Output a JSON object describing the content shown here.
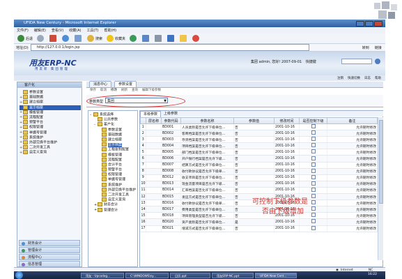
{
  "browser": {
    "title": "UFIDA New Century - Microsoft Internet Explorer",
    "menu": [
      "文件(F)",
      "编辑(E)",
      "查看(V)",
      "收藏(A)",
      "工具(T)",
      "帮助(H)"
    ],
    "toolbar": {
      "back": "后退",
      "search": "搜索",
      "favorites": "收藏夹"
    },
    "address_label": "地址(D)",
    "address": "http://127.0.0.1/login.jsp",
    "go": "转到",
    "links": "链接"
  },
  "app": {
    "logo": "用友ERP-NC",
    "logo_sub": "用友新    集团管理",
    "user_info": "集团 admin, 您好! 2007-09-01",
    "shortcut": "快捷键",
    "links": [
      "注销",
      "快速切换",
      "日志",
      "帮助"
    ]
  },
  "leftnav": {
    "header": "客户化",
    "items": [
      {
        "label": "参数设置",
        "exp": "",
        "sel": false
      },
      {
        "label": "基础数据",
        "exp": "+",
        "sel": false
      },
      {
        "label": "建立档案",
        "exp": "+",
        "sel": false
      },
      {
        "label": "显示档案",
        "exp": "+",
        "sel": true
      },
      {
        "label": "模板管理",
        "exp": "+",
        "sel": false
      },
      {
        "label": "流程配置",
        "exp": "+",
        "sel": false
      },
      {
        "label": "预警平台",
        "exp": "+",
        "sel": false
      },
      {
        "label": "权限管理",
        "exp": "+",
        "sel": false
      },
      {
        "label": "单据号管理",
        "exp": "+",
        "sel": false
      },
      {
        "label": "系统维护",
        "exp": "+",
        "sel": false
      },
      {
        "label": "外部交换平台维护",
        "exp": "+",
        "sel": false
      },
      {
        "label": "二次开发工具",
        "exp": "+",
        "sel": false
      },
      {
        "label": "自定义查询",
        "exp": "+",
        "sel": false
      }
    ],
    "bottom": [
      "财务会计",
      "管理会计",
      "流程中心",
      "信息管理"
    ]
  },
  "main": {
    "tabs": [
      "消息中心",
      "参数设置"
    ],
    "actions": [
      "保存",
      "取消",
      "修改",
      "刷新",
      "查询",
      "编辑下级参数"
    ],
    "filter_label": "参数类型",
    "filter_value": "集团",
    "tree": [
      {
        "label": "系统选择",
        "exp": "-",
        "indent": 0,
        "sel": false
      },
      {
        "label": "公共参数",
        "exp": "",
        "indent": 1,
        "sel": false
      },
      {
        "label": "客户化",
        "exp": "-",
        "indent": 1,
        "sel": false
      },
      {
        "label": "参数设置",
        "exp": "",
        "indent": 2,
        "sel": false
      },
      {
        "label": "基础数据",
        "exp": "",
        "indent": 2,
        "sel": false
      },
      {
        "label": "建立档案",
        "exp": "",
        "indent": 2,
        "sel": false
      },
      {
        "label": "显示档案",
        "exp": "",
        "indent": 2,
        "sel": true
      },
      {
        "label": "工程复制配置",
        "exp": "",
        "indent": 2,
        "sel": false
      },
      {
        "label": "模板管理",
        "exp": "",
        "indent": 2,
        "sel": false
      },
      {
        "label": "流程配置",
        "exp": "",
        "indent": 2,
        "sel": false
      },
      {
        "label": "会计平台",
        "exp": "",
        "indent": 2,
        "sel": false
      },
      {
        "label": "预警平台",
        "exp": "",
        "indent": 2,
        "sel": false
      },
      {
        "label": "权限管理",
        "exp": "",
        "indent": 2,
        "sel": false
      },
      {
        "label": "单据号管理",
        "exp": "",
        "indent": 2,
        "sel": false
      },
      {
        "label": "系统维护",
        "exp": "",
        "indent": 2,
        "sel": false
      },
      {
        "label": "外部交换平台维护",
        "exp": "",
        "indent": 2,
        "sel": false
      },
      {
        "label": "二次开发工具",
        "exp": "",
        "indent": 2,
        "sel": false
      },
      {
        "label": "自定义查询",
        "exp": "",
        "indent": 2,
        "sel": false
      },
      {
        "label": "财务会计",
        "exp": "+",
        "indent": 1,
        "sel": false
      },
      {
        "label": "管理会计",
        "exp": "+",
        "indent": 1,
        "sel": false
      }
    ],
    "subtabs": [
      "本级参数",
      "上级参数"
    ],
    "columns": [
      "",
      "层名称",
      "参数代码",
      "参数名称",
      "参数值",
      "修改时间",
      "是否控制下级",
      "备注"
    ],
    "rows": [
      {
        "n": "1",
        "code": "BD001",
        "name": "人员类别是否允许下级单位…",
        "val": "否",
        "time": "2001-10-16",
        "note": "允许随时修改"
      },
      {
        "n": "2",
        "code": "BD002",
        "name": "客商档案是否允许下级单位…",
        "val": "否",
        "time": "2001-10-16",
        "note": "允许随时修改"
      },
      {
        "n": "3",
        "code": "BD003",
        "name": "存货档案是否允许下级单位…",
        "val": "否",
        "time": "2001-10-16",
        "note": "允许随时修改"
      },
      {
        "n": "4",
        "code": "BD004",
        "name": "项目档案是否允许下级单位…",
        "val": "否",
        "time": "2001-10-16",
        "note": "允许随时修改"
      },
      {
        "n": "5",
        "code": "BD005",
        "name": "部门档案是否允许下级单位…",
        "val": "否",
        "time": "2001-10-16",
        "note": "允许随时修改"
      },
      {
        "n": "6",
        "code": "BD006",
        "name": "开户银行档案是否允许下级…",
        "val": "否",
        "time": "2001-10-16",
        "note": "允许随时修改"
      },
      {
        "n": "7",
        "code": "BD007",
        "name": "结算方式是否允许下级单位…",
        "val": "否",
        "time": "2001-10-16",
        "note": "允许随时修改"
      },
      {
        "n": "8",
        "code": "BD008",
        "name": "收付款协议是否允许下级单…",
        "val": "否",
        "time": "2001-10-16",
        "note": "允许随时修改"
      },
      {
        "n": "9",
        "code": "BD012",
        "name": "收支项目是否允许下级单位…",
        "val": "否",
        "time": "2001-10-16",
        "note": "允许随时修改"
      },
      {
        "n": "10",
        "code": "BD013",
        "name": "现金流量项目是否允许下级…",
        "val": "否",
        "time": "2001-10-16",
        "note": "允许随时修改"
      },
      {
        "n": "11",
        "code": "BD014",
        "name": "汇率档案是否允许下级单位…",
        "val": "否",
        "time": "2001-10-16",
        "note": "允许随时修改"
      },
      {
        "n": "12",
        "code": "BD015",
        "name": "发运方式是否允许下级单位…",
        "val": "否",
        "time": "2001-10-16",
        "note": "允许随时修改"
      },
      {
        "n": "13",
        "code": "BD016",
        "name": "收付款协议是否允许下级单…",
        "val": "否",
        "time": "2001-10-16",
        "note": "允许随时修改"
      },
      {
        "n": "14",
        "code": "BD017",
        "name": "费用类型是否允许下级单位…",
        "val": "否",
        "time": "2001-10-16",
        "note": "允许随时修改"
      },
      {
        "n": "15",
        "code": "BD018",
        "name": "项目管理类型是否允许下级…",
        "val": "否",
        "time": "2001-10-16",
        "note": "允许随时修改"
      },
      {
        "n": "16",
        "code": "BD020",
        "name": "资产类别是否允许下级单位…",
        "val": "是",
        "time": "2001-10-16",
        "note": "允许随时修改"
      },
      {
        "n": "17",
        "code": "BD021",
        "name": "增减方式是否允许下级单位…",
        "val": "否",
        "time": "2001-10-16",
        "note": "允许随时修改"
      }
    ],
    "annotation": [
      "可控制下级参数是",
      "否由下级增加"
    ]
  },
  "status": {
    "zone": "Internet",
    "zoom": "NC"
  },
  "taskbar": [
    "用友 - Upcodog...",
    "C:\\WINDOWS\\sy...",
    "日历.ppt",
    "用友ERP-NC.ppt",
    "UFIDA New Cent..."
  ],
  "clock": "16:22",
  "colors": {
    "brand": "#1b3d8f",
    "selection": "#2d5fb8",
    "annotation": "#d0302a"
  }
}
